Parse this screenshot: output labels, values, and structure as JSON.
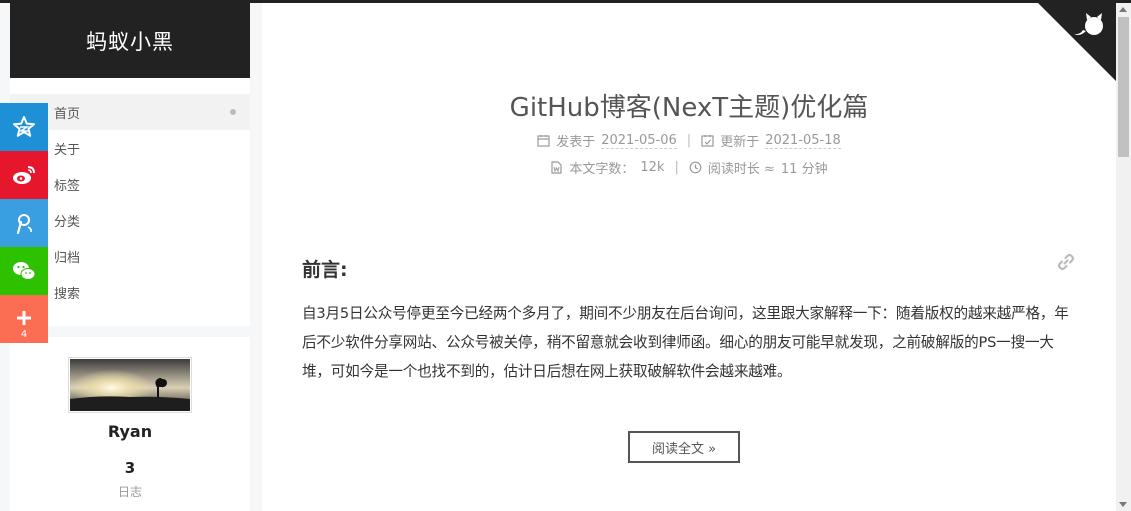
{
  "site": {
    "title": "蚂蚁小黑"
  },
  "menu": {
    "items": [
      {
        "label": "首页",
        "active": true
      },
      {
        "label": "关于"
      },
      {
        "label": "标签"
      },
      {
        "label": "分类"
      },
      {
        "label": "归档"
      },
      {
        "label": "搜索"
      }
    ]
  },
  "share": {
    "buttons": [
      "qzone-icon",
      "weibo-icon",
      "tencent-weibo-icon",
      "wechat-icon",
      "plus-icon"
    ],
    "count": "4",
    "colors": {
      "qzone": "#1e90d6",
      "weibo": "#e6162d",
      "tweibo": "#3a9fe0",
      "wechat": "#2ec100",
      "more": "#fb6e53"
    }
  },
  "profile": {
    "name": "Ryan",
    "posts_count": "3",
    "posts_label": "日志"
  },
  "post": {
    "title": "GitHub博客(NexT主题)优化篇",
    "published_label": "发表于",
    "published_date": "2021-05-06",
    "updated_label": "更新于",
    "updated_date": "2021-05-18",
    "wordcount_label": "本文字数：",
    "wordcount": "12k",
    "readtime_label": "阅读时长 ≈",
    "readtime": "11 分钟",
    "heading": "前言:",
    "excerpt": "自3月5日公众号停更至今已经两个多月了，期间不少朋友在后台询问，这里跟大家解释一下：随着版权的越来越严格，年后不少软件分享网站、公众号被关停，稍不留意就会收到律师函。细心的朋友可能早就发现，之前破解版的PS一搜一大堆，可如今是一个也找不到的，估计日后想在网上获取破解软件会越来越难。",
    "read_more": "阅读全文 »"
  },
  "github_corner": {
    "icon": "github-octocat-icon"
  }
}
